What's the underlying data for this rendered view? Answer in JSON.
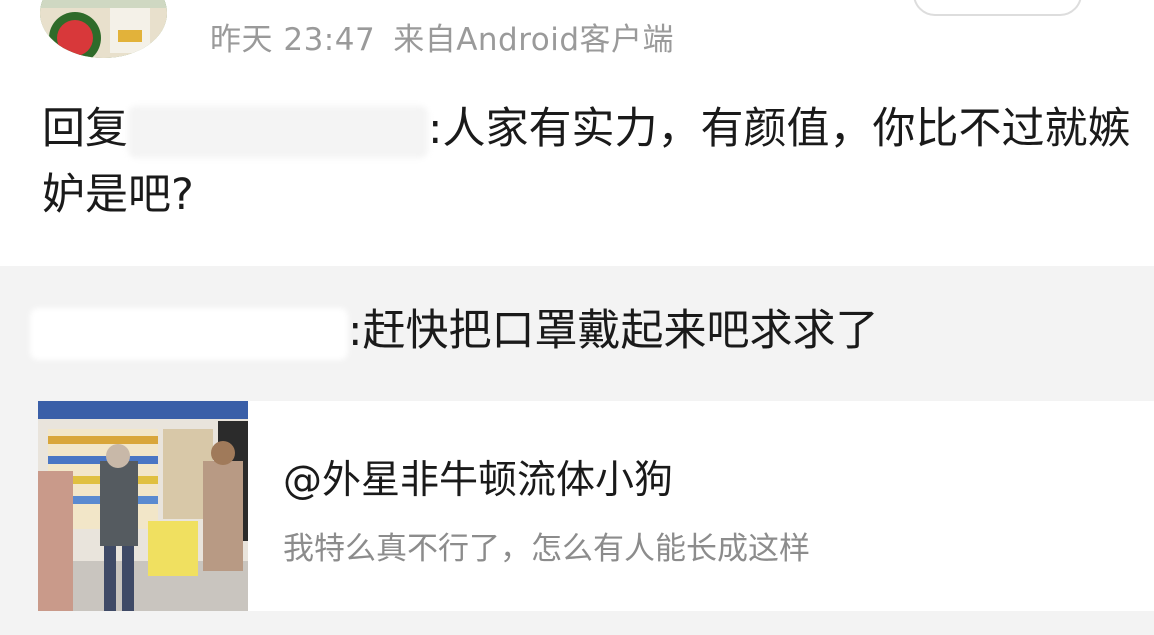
{
  "comment": {
    "time": "昨天 23:47",
    "source": "来自Android客户端",
    "reply_prefix": "回复",
    "reply_text": ":人家有实力，有颜值，你比不过就嫉妒是吧?"
  },
  "quoted": {
    "text": ":赶快把口罩戴起来吧求求了"
  },
  "share_card": {
    "title": "@外星非牛顿流体小狗",
    "description": "我特么真不行了，怎么有人能长成这样"
  }
}
